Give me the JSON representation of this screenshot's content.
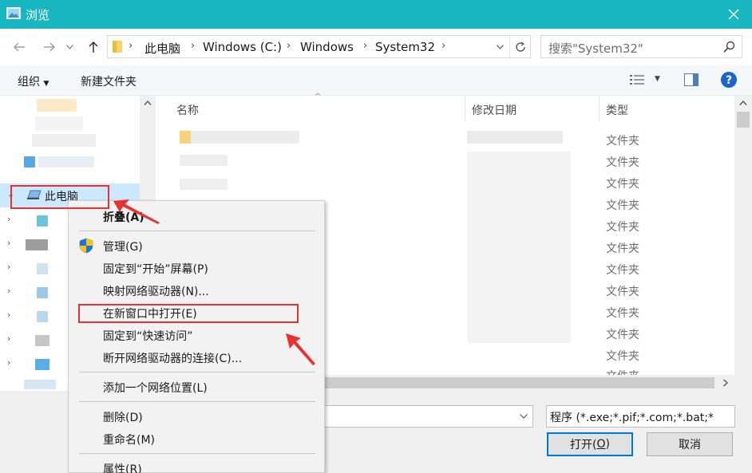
{
  "window": {
    "title": "浏览"
  },
  "address": {
    "crumbs": [
      "此电脑",
      "Windows (C:)",
      "Windows",
      "System32"
    ]
  },
  "search": {
    "placeholder": "搜索\"System32\""
  },
  "toolbar": {
    "organize": "组织",
    "new_folder": "新建文件夹"
  },
  "nav": {
    "this_pc": "此电脑"
  },
  "columns": {
    "name": "名称",
    "modified": "修改日期",
    "type": "类型"
  },
  "rows": {
    "type_value": "文件夹"
  },
  "bottom": {
    "filter": "程序 (*.exe;*.pif;*.com;*.bat;*",
    "open_label": "打开(",
    "open_key": "O",
    "open_close": ")",
    "cancel_label": "取消"
  },
  "context_menu": {
    "collapse": "折叠(A)",
    "manage": "管理(G)",
    "pin_start": "固定到“开始”屏幕(P)",
    "map_drive": "映射网络驱动器(N)...",
    "open_new_window": "在新窗口中打开(E)",
    "pin_quick": "固定到“快速访问”",
    "disconnect_drive": "断开网络驱动器的连接(C)...",
    "add_location": "添加一个网络位置(L)",
    "delete": "删除(D)",
    "rename": "重命名(M)",
    "properties": "属性(R)"
  },
  "colors": {
    "titlebar": "#18b6c0",
    "highlight": "#e83232",
    "selection": "#cce8ff"
  }
}
